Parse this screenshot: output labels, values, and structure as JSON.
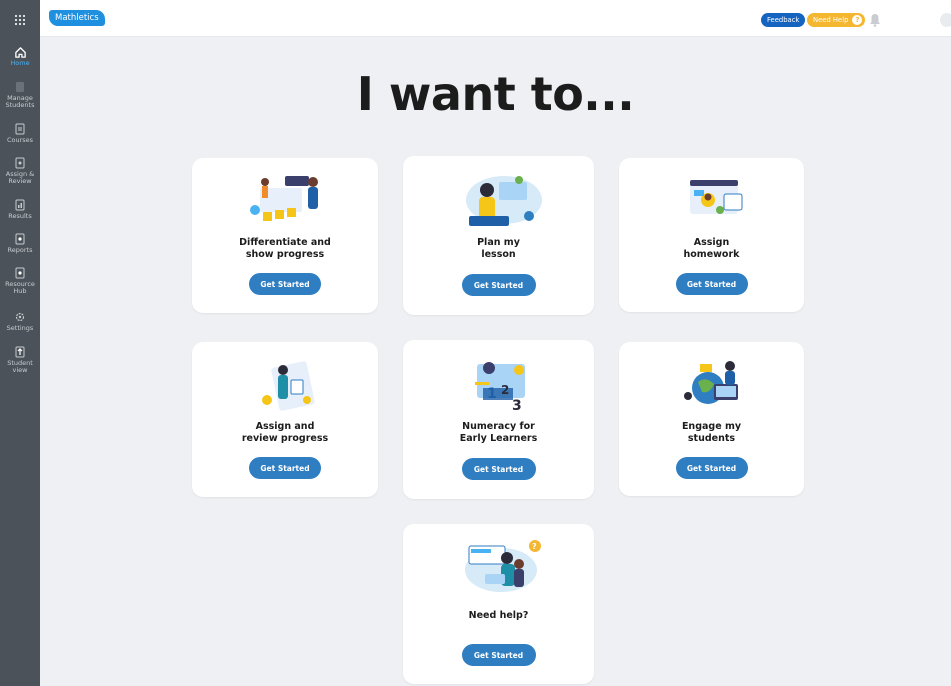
{
  "header": {
    "logo": "Mathletics",
    "feedback_label": "Feedback",
    "need_help_label": "Need Help",
    "need_help_icon": "?"
  },
  "sidebar": {
    "items": [
      {
        "label": "Home",
        "icon": "home-icon",
        "active": true
      },
      {
        "label": "Manage Students",
        "icon": "users-icon",
        "active": false
      },
      {
        "label": "Courses",
        "icon": "courses-icon",
        "active": false
      },
      {
        "label": "Assign & Review",
        "icon": "assign-icon",
        "active": false
      },
      {
        "label": "Results",
        "icon": "results-icon",
        "active": false
      },
      {
        "label": "Reports",
        "icon": "reports-icon",
        "active": false
      },
      {
        "label": "Resource Hub",
        "icon": "resource-icon",
        "active": false
      },
      {
        "label": "Settings",
        "icon": "gear-icon",
        "active": false
      },
      {
        "label": "Student view",
        "icon": "student-view-icon",
        "active": false
      }
    ]
  },
  "main": {
    "title": "I want to...",
    "button_label": "Get Started",
    "cards": [
      {
        "title": "Differentiate and\nshow progress",
        "illustration": "differentiate-illustration"
      },
      {
        "title": "Plan my\nlesson",
        "illustration": "plan-lesson-illustration"
      },
      {
        "title": "Assign\nhomework",
        "illustration": "homework-illustration"
      },
      {
        "title": "Assign and\nreview progress",
        "illustration": "review-illustration"
      },
      {
        "title": "Numeracy for\nEarly Learners",
        "illustration": "numeracy-illustration"
      },
      {
        "title": "Engage my\nstudents",
        "illustration": "engage-illustration"
      },
      {
        "title": "Need help?",
        "illustration": "help-illustration"
      }
    ]
  },
  "colors": {
    "sidebar_bg": "#4c5259",
    "accent_blue": "#2f7ec2",
    "feedback_blue": "#1565c0",
    "help_yellow": "#f5b731",
    "main_bg": "#eef0f3"
  }
}
